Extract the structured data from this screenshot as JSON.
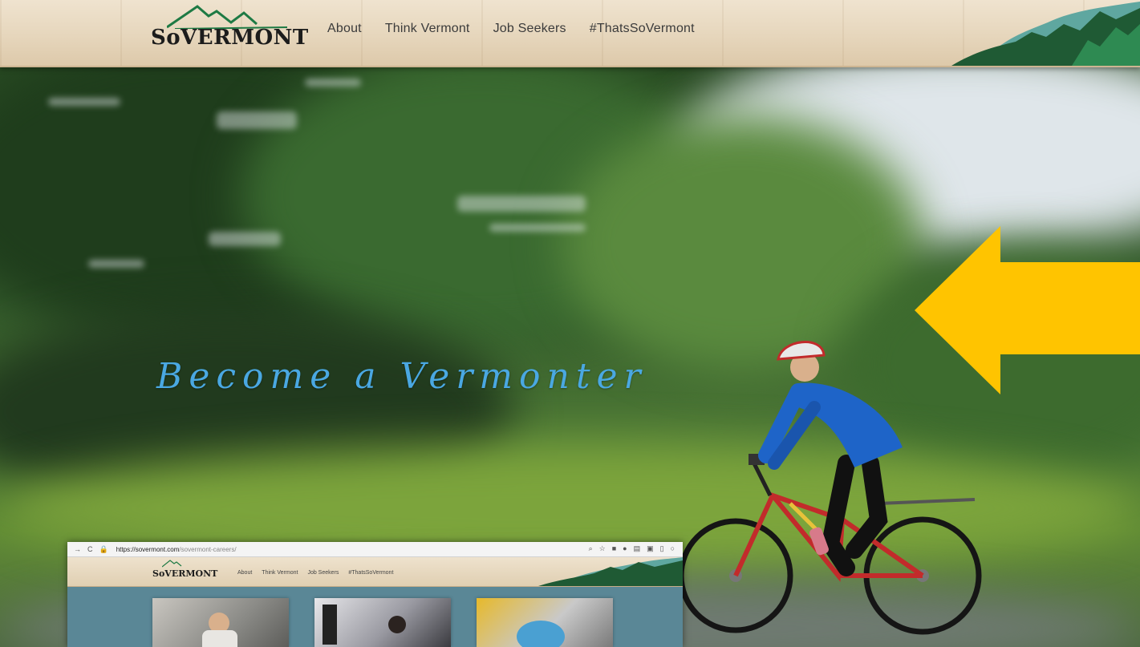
{
  "header": {
    "logo_text": "SoVERMONT",
    "nav": [
      "About",
      "Think Vermont",
      "Job Seekers",
      "#ThatsSoVermont"
    ]
  },
  "hero": {
    "tagline": "Become a Vermonter"
  },
  "inset": {
    "url_host": "https://sovermont.com",
    "url_path": "/sovermont-careers/",
    "logo_text": "SoVERMONT",
    "nav": [
      "About",
      "Think Vermont",
      "Job Seekers",
      "#ThatsSoVermont"
    ]
  },
  "colors": {
    "arrow": "#ffc400",
    "tagline": "#4aa8e2",
    "header_bg": "#e9dcc4",
    "mountain_dark": "#1f5a34",
    "mountain_light": "#3a9a6a"
  },
  "icons": [
    "back-icon",
    "reload-icon",
    "lock-icon",
    "zoom-icon",
    "star-icon",
    "left-arrow-icon",
    "cyclist-icon"
  ]
}
